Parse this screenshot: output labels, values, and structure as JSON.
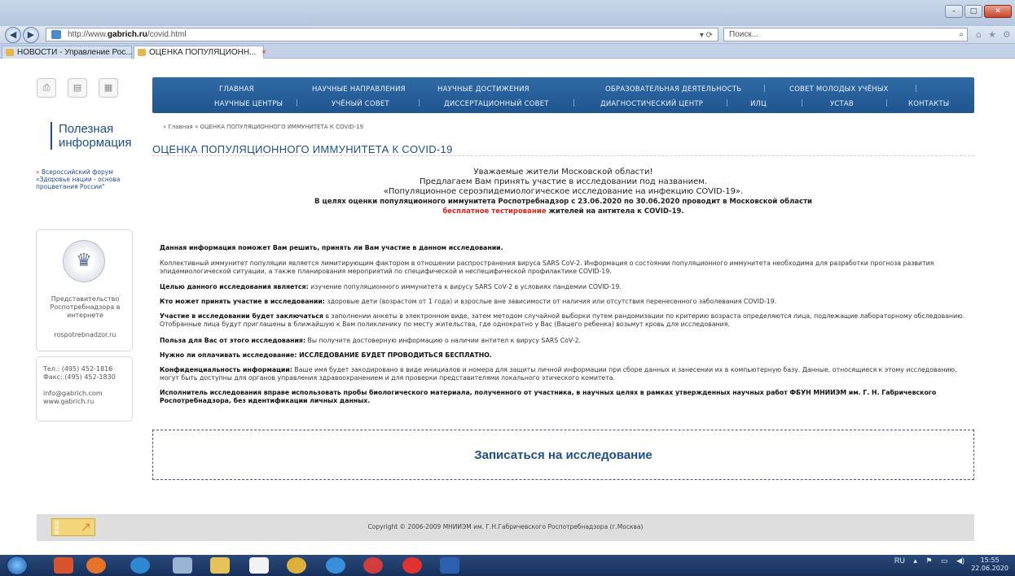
{
  "browser": {
    "url_prefix": "http://www.",
    "url_host": "gabrich.ru",
    "url_path": "/covid.html",
    "url_tools": "▾ ⟳",
    "search_placeholder": "Поиск...",
    "tabs": [
      {
        "label": "НОВОСТИ - Управление Рос..."
      },
      {
        "label": "ОЦЕНКА ПОПУЛЯЦИОНН...",
        "close": "×"
      }
    ]
  },
  "menu": {
    "row1": [
      "ГЛАВНАЯ",
      "НАУЧНЫЕ НАПРАВЛЕНИЯ",
      "НАУЧНЫЕ ДОСТИЖЕНИЯ",
      "ОБРАЗОВАТЕЛЬНАЯ ДЕЯТЕЛЬНОСТЬ",
      "СОВЕТ МОЛОДЫХ УЧЁНЫХ"
    ],
    "row2": [
      "НАУЧНЫЕ ЦЕНТРЫ",
      "УЧЁНЫЙ СОВЕТ",
      "ДИССЕРТАЦИОННЫЙ СОВЕТ",
      "ДИАГНОСТИЧЕСКИЙ ЦЕНТР",
      "ИЛЦ",
      "УСТАВ",
      "КОНТАКТЫ"
    ]
  },
  "sidebar": {
    "title": "Полезная информация",
    "link": "Всероссийский форум «Здоровье нации - основа процветания России\"",
    "rospotreb_text": "Представительство Роспотребнадзора в интернете",
    "rospotreb_link": "rospotrebnadzor.ru",
    "tel": "Тел.: (495) 452-1816",
    "fax": "Факс: (495) 452-1830",
    "email": "info@gabrich.com",
    "site": "www.gabrich.ru"
  },
  "breadcrumb": {
    "home": "Главная",
    "sep": "»",
    "current": "ОЦЕНКА ПОПУЛЯЦИОННОГО ИММУНИТЕТА К COVID-19"
  },
  "page_title": "ОЦЕНКА ПОПУЛЯЦИОННОГО ИММУНИТЕТА К COVID-19",
  "greeting": {
    "line1": "Уважаемые жители Московской области!",
    "line2": "Предлагаем Вам принять участие в исследовании под названием.",
    "line3": "«Популяционное сероэпидемиологическое исследование на инфекцию COVID-19».",
    "line4": "В целях оценки популяционного иммунитета Роспотребнадзор с 23.06.2020 по 30.06.2020 проводит в Московской области",
    "line5_red": "бесплатное тестирование",
    "line5_rest": " жителей на антитела к COVID-19."
  },
  "content": {
    "intro": "Данная информация поможет Вам решить, принять ли Вам участие в данном исследовании.",
    "p1": "Коллективный иммунитет популяции является лимитирующим фактором в отношении распространения вируса SARS CoV-2. Информация о состоянии популяционного иммунитета необходима для разработки прогноза развития эпидемиологической ситуации, а также планирования мероприятий по специфической и неспецифической профилактике COVID-19.",
    "p2_bold": "Целью данного исследования является:",
    "p2": " изучение популяционного иммунитета к вирусу SARS CoV-2 в условиях пандемии COVID-19.",
    "p3_bold": "Кто может принять участие в исследовании:",
    "p3": " здоровые дети (возрастом от 1 года) и взрослые вне зависимости от наличия или отсутствия перенесенного заболевания COVID-19.",
    "p4_bold": "Участие в исследовании будет заключаться",
    "p4": " в заполнении анкеты в электронном виде, затем методом случайной выборки путем рандомизации по критерию возраста определяются лица, подлежащие лабораторному обследованию. Отобранные лица будут приглашены в ближайшую к Вам поликлинику по месту жительства, где однократно у Вас (Вашего ребенка) возьмут кровь для исследования.",
    "p5_bold": "Польза для Вас от этого исследования:",
    "p5": " Вы получите достоверную информацию о наличии антител к вирусу SARS CoV-2.",
    "p6_red": "Нужно ли оплачивать исследование: ИССЛЕДОВАНИЕ БУДЕТ ПРОВОДИТЬСЯ БЕСПЛАТНО.",
    "p7_bold": "Конфиденциальность информации:",
    "p7": " Ваше имя будет закодировано в виде инициалов и номера для защиты личной информации при сборе данных и занесении их в компьютерную базу. Данные, относящиеся к этому исследованию, могут быть доступны для органов управления здравоохранением и для проверки представителями локального этического комитета.",
    "p8": "Исполнитель исследования вправе использовать пробы биологического материала, полученного от участника, в научных целях в рамках утвержденных научных работ ФБУН МНИИЭМ им. Г. Н. Габричевского Роспотребнадзора, без идентификации личных данных."
  },
  "signup_label": "Записаться на исследование",
  "footer": {
    "copyright": "Copyright © 2006-2009 МНИИЭМ им. Г.Н.Габричевского Роспотребнадзора (г.Москва)"
  },
  "taskbar": {
    "lang": "RU",
    "time": "15:55",
    "date": "22.06.2020"
  },
  "colors": {
    "menu_blue": "#1f5590",
    "accent_red": "#e2231a",
    "link_blue": "#1f4f8a"
  }
}
